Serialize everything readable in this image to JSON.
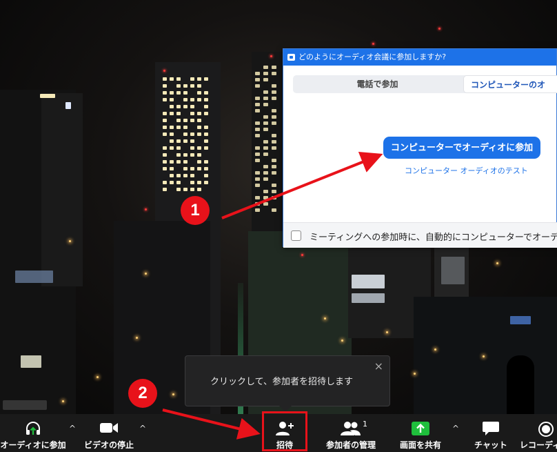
{
  "dialog": {
    "title": "どのようにオーディオ会議に参加しますか?",
    "tabs": [
      {
        "label": "電話で参加"
      },
      {
        "label": "コンピューターのオ"
      }
    ],
    "join_button": "コンピューターでオーディオに参加",
    "test_link": "コンピューター オーディオのテスト",
    "auto_join_checkbox": "ミーティングへの参加時に、自動的にコンピューターでオーディオ"
  },
  "tooltip": {
    "text": "クリックして、参加者を招待します",
    "close": "×"
  },
  "toolbar": {
    "items": [
      {
        "label": "オーディオに参加",
        "icon": "headphones-icon"
      },
      {
        "label": "ビデオの停止",
        "icon": "video-camera-icon"
      },
      {
        "label": "招待",
        "icon": "add-person-icon"
      },
      {
        "label": "参加者の管理",
        "icon": "participants-icon",
        "badge": "1"
      },
      {
        "label": "画面を共有",
        "icon": "share-screen-icon"
      },
      {
        "label": "チャット",
        "icon": "chat-icon"
      },
      {
        "label": "レコーディ",
        "icon": "record-icon"
      }
    ],
    "caret": "^"
  },
  "annotations": {
    "step1": "1",
    "step2": "2"
  },
  "colors": {
    "accent": "#1d72e8",
    "annotation_red": "#e8121a",
    "share_green": "#1fbf3c",
    "toolbar_bg": "#1a1a1a"
  }
}
